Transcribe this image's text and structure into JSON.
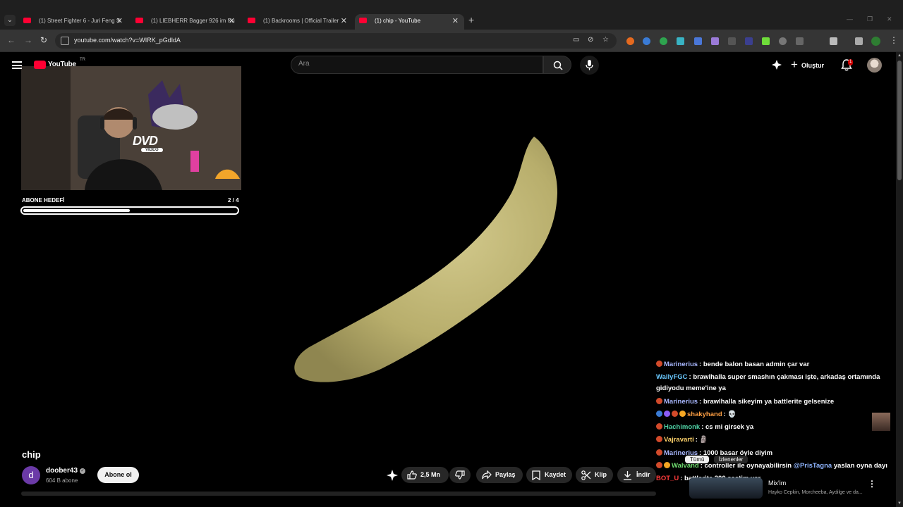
{
  "browser": {
    "tabs": [
      {
        "title": "(1) Street Fighter 6 - Juri Feng S",
        "active": false
      },
      {
        "title": "(1) LIEBHERR Bagger 926 im Nu",
        "active": false
      },
      {
        "title": "(1) Backrooms | Official Trailer",
        "active": false
      },
      {
        "title": "(1) chip - YouTube",
        "active": true
      }
    ],
    "url": "youtube.com/watch?v=WIRK_pGdldA"
  },
  "header": {
    "logo_text": "YouTube",
    "country_code": "TR",
    "search_placeholder": "Ara",
    "create_label": "Oluştur",
    "notification_count": "1"
  },
  "overlay": {
    "goal_label": "ABONE HEDEFİ",
    "goal_count": "2 / 4",
    "goal_progress": 0.5,
    "dvd_text": "DVD",
    "dvd_sub": "VIDEO"
  },
  "chat": [
    {
      "badges": [
        "#d24a2a"
      ],
      "user": "Marinerius",
      "user_color": "#a9b8ff",
      "text": ": bende balon basan admin çar var"
    },
    {
      "badges": [],
      "user": "WallyFGC",
      "user_color": "#6ac9ff",
      "text": ": brawlhalla super smashın çakması işte, arkadaş ortamında gidiyodu meme'ine ya"
    },
    {
      "badges": [
        "#d24a2a"
      ],
      "user": "Marinerius",
      "user_color": "#a9b8ff",
      "text": ": brawlhalla sikeyim ya battlerite gelsenize"
    },
    {
      "badges": [
        "#3a7bd5",
        "#8b5cf6",
        "#d24a2a",
        "#f5a623"
      ],
      "user": "shakyhand",
      "user_color": "#ff9f43",
      "text": ": 💀"
    },
    {
      "badges": [
        "#d24a2a"
      ],
      "user": "Hachimonk",
      "user_color": "#4fd1a5",
      "text": ": cs mi girsek ya"
    },
    {
      "badges": [
        "#d24a2a"
      ],
      "user": "Vajravarti",
      "user_color": "#ffd36b",
      "text": ": 🗿"
    },
    {
      "badges": [
        "#d24a2a"
      ],
      "user": "Marinerius",
      "user_color": "#a9b8ff",
      "text": ": 1000 basar öyle diyim"
    },
    {
      "badges": [
        "#d24a2a",
        "#f5a623"
      ],
      "user": "Walvand",
      "user_color": "#6fdc6f",
      "text": ": controller ile oynayabilirsin ",
      "mention": "@PrisTagna",
      "after": " yaslan oyna dayı"
    },
    {
      "badges": [],
      "user": "BOT_U",
      "user_color": "#ff3b3b",
      "text": ": battlerite 300 saatim var"
    }
  ],
  "video": {
    "title": "chip",
    "channel": "doober43",
    "channel_initial": "d",
    "subscribers": "604 B abone",
    "subscribe_label": "Abone ol",
    "likes": "2,5 Mn",
    "share_label": "Paylaş",
    "save_label": "Kaydet",
    "clip_label": "Klip",
    "download_label": "İndir"
  },
  "sidebar": {
    "pills": [
      "Tümü",
      "İzlenenler"
    ],
    "mix_title": "Mix'im",
    "mix_sub": "Hayko Cepkin, Morcheeba, Aydilge ve da..."
  }
}
